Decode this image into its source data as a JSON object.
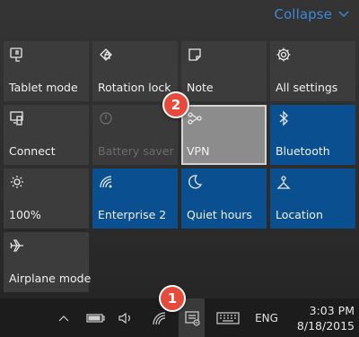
{
  "header": {
    "collapse_label": "Collapse"
  },
  "tiles": [
    {
      "label": "Tablet mode",
      "icon": "tablet-mode-icon"
    },
    {
      "label": "Rotation lock",
      "icon": "rotation-lock-icon"
    },
    {
      "label": "Note",
      "icon": "note-icon"
    },
    {
      "label": "All settings",
      "icon": "settings-gear-icon"
    },
    {
      "label": "Connect",
      "icon": "connect-icon"
    },
    {
      "label": "Battery saver",
      "icon": "battery-saver-icon",
      "state": "disabled"
    },
    {
      "label": "VPN",
      "icon": "vpn-icon",
      "state": "selected"
    },
    {
      "label": "Bluetooth",
      "icon": "bluetooth-icon",
      "state": "on"
    },
    {
      "label": "100%",
      "icon": "brightness-icon"
    },
    {
      "label": "Enterprise 2",
      "icon": "wifi-icon",
      "state": "on"
    },
    {
      "label": "Quiet hours",
      "icon": "moon-icon",
      "state": "on"
    },
    {
      "label": "Location",
      "icon": "location-icon",
      "state": "on"
    },
    {
      "label": "Airplane mode",
      "icon": "airplane-icon"
    }
  ],
  "callouts": {
    "first": "1",
    "second": "2"
  },
  "taskbar": {
    "language": "ENG",
    "time": "3:03 PM",
    "date": "8/18/2015"
  },
  "colors": {
    "accent": "#0a4f8f",
    "collapse_link": "#3c8ad8",
    "callout": "#e64a3b"
  }
}
